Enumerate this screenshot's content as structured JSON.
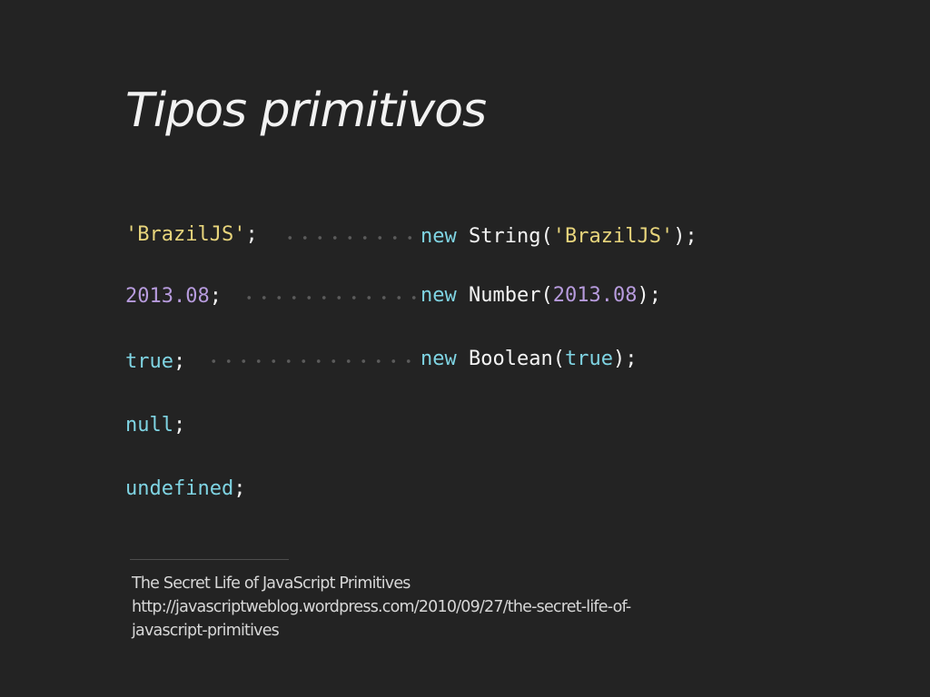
{
  "slide": {
    "title": "Tipos primitivos",
    "literals": [
      {
        "value": "'BrazilJS'",
        "suffix": ";"
      },
      {
        "value": "2013.08",
        "suffix": ";"
      },
      {
        "value": "true",
        "suffix": ";"
      },
      {
        "value": "null",
        "suffix": ";"
      },
      {
        "value": "undefined",
        "suffix": ";"
      }
    ],
    "wrappers": [
      {
        "keyword": "new",
        "constructor": "String",
        "open": "(",
        "arg": "'BrazilJS'",
        "close": ");"
      },
      {
        "keyword": "new",
        "constructor": "Number",
        "open": "(",
        "arg": "2013.08",
        "close": ");"
      },
      {
        "keyword": "new",
        "constructor": "Boolean",
        "open": "(",
        "arg": "true",
        "close": ");"
      }
    ],
    "reference": {
      "title": "The Secret Life of JavaScript Primitives",
      "url_line1": "http://javascriptweblog.wordpress.com/2010/09/27/the-secret-life-of-",
      "url_line2": "javascript-primitives"
    }
  },
  "colors": {
    "background": "#232323",
    "text": "#f4f4f4",
    "string": "#e8d57c",
    "number": "#b79bdd",
    "keyword": "#7fd4e3",
    "dots": "#5b5b5b"
  }
}
